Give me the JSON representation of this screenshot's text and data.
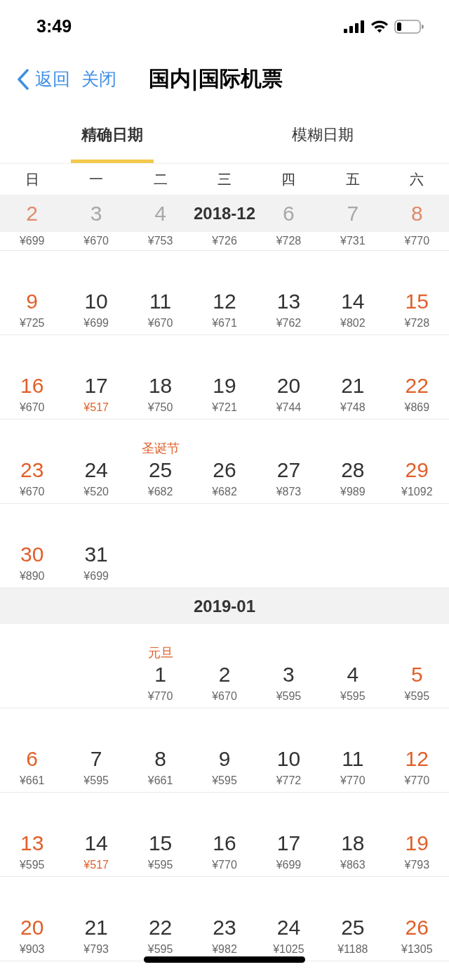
{
  "status_bar": {
    "time": "3:49"
  },
  "nav": {
    "back": "返回",
    "close": "关闭",
    "title": "国内|国际机票"
  },
  "tabs": [
    {
      "label": "精确日期",
      "selected": true
    },
    {
      "label": "模糊日期",
      "selected": false
    }
  ],
  "weekdays": [
    "日",
    "一",
    "二",
    "三",
    "四",
    "五",
    "六"
  ],
  "months": [
    {
      "title": "2018-12",
      "weeks": [
        {
          "past": true,
          "days": [
            {
              "day": "2",
              "price": "¥699",
              "low": false
            },
            {
              "day": "3",
              "price": "¥670",
              "low": false
            },
            {
              "day": "4",
              "price": "¥753",
              "low": false
            },
            {
              "price": "¥726",
              "low": false
            },
            {
              "day": "6",
              "price": "¥728",
              "low": false
            },
            {
              "day": "7",
              "price": "¥731",
              "low": false
            },
            {
              "day": "8",
              "price": "¥770",
              "low": false
            }
          ]
        },
        {
          "past": false,
          "days": [
            {
              "day": "9",
              "price": "¥725",
              "low": false
            },
            {
              "day": "10",
              "price": "¥699",
              "low": false
            },
            {
              "day": "11",
              "price": "¥670",
              "low": false
            },
            {
              "day": "12",
              "price": "¥671",
              "low": false
            },
            {
              "day": "13",
              "price": "¥762",
              "low": false
            },
            {
              "day": "14",
              "price": "¥802",
              "low": false
            },
            {
              "day": "15",
              "price": "¥728",
              "low": false
            }
          ]
        },
        {
          "past": false,
          "days": [
            {
              "day": "16",
              "price": "¥670",
              "low": false
            },
            {
              "day": "17",
              "price": "¥517",
              "low": true
            },
            {
              "day": "18",
              "price": "¥750",
              "low": false
            },
            {
              "day": "19",
              "price": "¥721",
              "low": false
            },
            {
              "day": "20",
              "price": "¥744",
              "low": false
            },
            {
              "day": "21",
              "price": "¥748",
              "low": false
            },
            {
              "day": "22",
              "price": "¥869",
              "low": false
            }
          ]
        },
        {
          "past": false,
          "days": [
            {
              "day": "23",
              "price": "¥670",
              "low": false
            },
            {
              "day": "24",
              "price": "¥520",
              "low": false
            },
            {
              "day": "25",
              "price": "¥682",
              "low": false,
              "holiday": "圣诞节"
            },
            {
              "day": "26",
              "price": "¥682",
              "low": false
            },
            {
              "day": "27",
              "price": "¥873",
              "low": false
            },
            {
              "day": "28",
              "price": "¥989",
              "low": false
            },
            {
              "day": "29",
              "price": "¥1092",
              "low": false
            }
          ]
        },
        {
          "past": false,
          "days": [
            {
              "day": "30",
              "price": "¥890",
              "low": false
            },
            {
              "day": "31",
              "price": "¥699",
              "low": false
            }
          ]
        }
      ]
    },
    {
      "title": "2019-01",
      "weeks": [
        {
          "past": false,
          "days": [
            {
              "day": "1",
              "price": "¥770",
              "low": false,
              "holiday": "元旦"
            },
            {
              "day": "2",
              "price": "¥670",
              "low": false
            },
            {
              "day": "3",
              "price": "¥595",
              "low": false
            },
            {
              "day": "4",
              "price": "¥595",
              "low": false
            },
            {
              "day": "5",
              "price": "¥595",
              "low": false
            }
          ]
        },
        {
          "past": false,
          "days": [
            {
              "day": "6",
              "price": "¥661",
              "low": false
            },
            {
              "day": "7",
              "price": "¥595",
              "low": false
            },
            {
              "day": "8",
              "price": "¥661",
              "low": false
            },
            {
              "day": "9",
              "price": "¥595",
              "low": false
            },
            {
              "day": "10",
              "price": "¥772",
              "low": false
            },
            {
              "day": "11",
              "price": "¥770",
              "low": false
            },
            {
              "day": "12",
              "price": "¥770",
              "low": false
            }
          ]
        },
        {
          "past": false,
          "days": [
            {
              "day": "13",
              "price": "¥595",
              "low": false
            },
            {
              "day": "14",
              "price": "¥517",
              "low": true
            },
            {
              "day": "15",
              "price": "¥595",
              "low": false
            },
            {
              "day": "16",
              "price": "¥770",
              "low": false
            },
            {
              "day": "17",
              "price": "¥699",
              "low": false
            },
            {
              "day": "18",
              "price": "¥863",
              "low": false
            },
            {
              "day": "19",
              "price": "¥793",
              "low": false
            }
          ]
        },
        {
          "past": false,
          "days": [
            {
              "day": "20",
              "price": "¥903",
              "low": false
            },
            {
              "day": "21",
              "price": "¥793",
              "low": false
            },
            {
              "day": "22",
              "price": "¥595",
              "low": false
            },
            {
              "day": "23",
              "price": "¥982",
              "low": false
            },
            {
              "day": "24",
              "price": "¥1025",
              "low": false
            },
            {
              "day": "25",
              "price": "¥1188",
              "low": false
            },
            {
              "day": "26",
              "price": "¥1305",
              "low": false
            }
          ]
        }
      ]
    }
  ]
}
